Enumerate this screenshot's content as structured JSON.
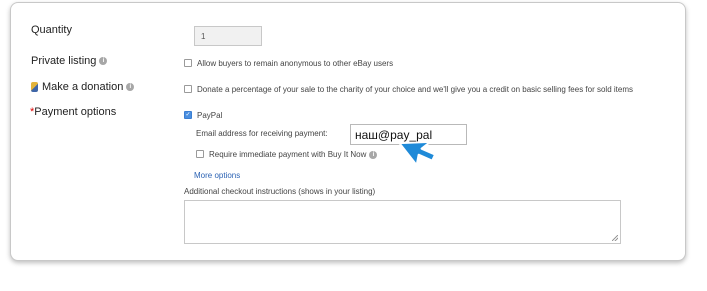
{
  "form": {
    "quantity": {
      "label": "Quantity",
      "value": "1"
    },
    "private_listing": {
      "label": "Private listing",
      "checkbox_label": "Allow buyers to remain anonymous to other eBay users",
      "checked": false,
      "info_icon": "info-icon"
    },
    "donation": {
      "label": "Make a donation",
      "checkbox_label": "Donate a percentage of your sale to the charity of your choice and we'll give you a credit on basic selling fees for sold items",
      "checked": false,
      "icon": "ribbon-icon",
      "info_icon": "info-icon"
    },
    "payment": {
      "required_mark": "*",
      "label": "Payment options",
      "paypal_label": "PayPal",
      "paypal_checked": true,
      "email_label": "Email address for receiving payment:",
      "email_value": "наш@pay_pal",
      "immediate_label": "Require immediate payment with Buy It Now",
      "immediate_checked": false,
      "info_icon": "info-icon"
    },
    "more_options": "More options",
    "instructions_label": "Additional checkout instructions (shows in your listing)",
    "instructions_value": ""
  },
  "colors": {
    "link": "#2c63b4",
    "checkbox_checked": "#4a8fe0",
    "cursor": "#1f8ad8"
  },
  "cursor_icon": "arrow-pointer-icon"
}
